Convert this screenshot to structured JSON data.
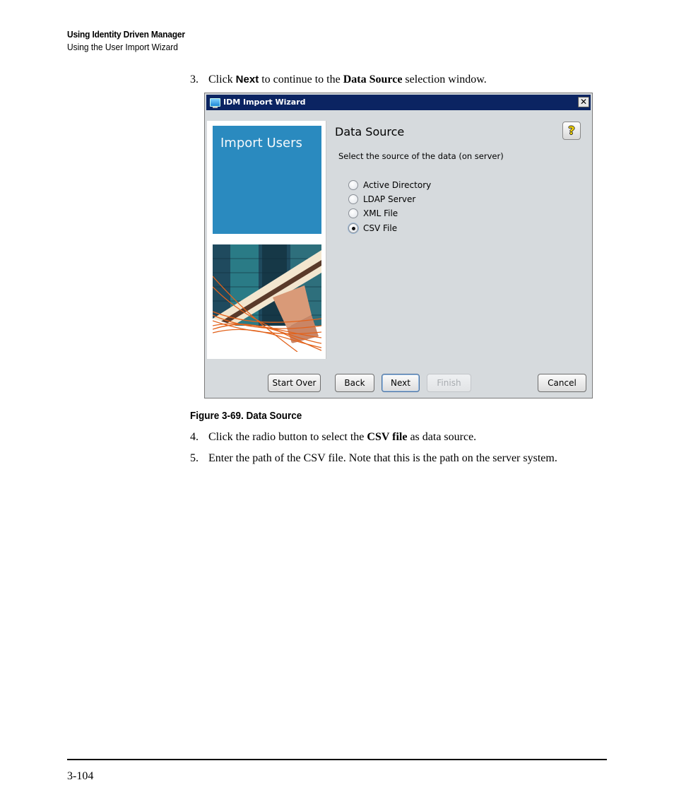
{
  "header": {
    "chapter": "Using Identity Driven Manager",
    "section": "Using the User Import Wizard"
  },
  "steps": [
    {
      "number": "3.",
      "parts": [
        "Click ",
        "Next",
        " to continue to the ",
        "Data Source",
        " selection window."
      ]
    },
    {
      "number": "4.",
      "parts": [
        "Click the radio button to select the ",
        "CSV file",
        " as data source."
      ]
    },
    {
      "number": "5.",
      "parts": [
        "Enter the path of the CSV file. Note that this is the path on the server system."
      ]
    }
  ],
  "figure": {
    "caption": "Figure 3-69. Data Source"
  },
  "window": {
    "title": "IDM Import Wizard",
    "close_icon": "close-icon",
    "banner_text": "Import Users",
    "section_title": "Data Source",
    "help_icon": "help-question-icon",
    "help_glyph": "?",
    "close_glyph": "✕",
    "instruction": "Select the source of the data (on server)",
    "options": [
      {
        "label": "Active Directory",
        "checked": false
      },
      {
        "label": "LDAP Server",
        "checked": false
      },
      {
        "label": "XML File",
        "checked": false
      },
      {
        "label": "CSV File",
        "checked": true
      }
    ],
    "buttons": {
      "start_over": "Start Over",
      "back": "Back",
      "next": "Next",
      "finish": "Finish",
      "cancel": "Cancel"
    }
  },
  "footer": {
    "page_number": "3-104"
  }
}
